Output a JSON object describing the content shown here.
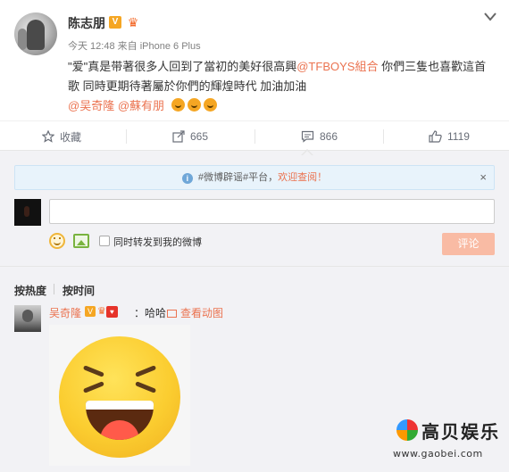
{
  "post": {
    "username": "陈志朋",
    "v_badge": "V",
    "time": "今天 12:48",
    "source_prefix": "来自",
    "source": "iPhone 6 Plus",
    "text_part1": "\"爱\"真是带著很多人回到了當初的美好很高興",
    "text_mention1": "@TFBOYS組合",
    "text_part2": " 你們三隻也喜歡這首歌 同時更期待著屬於你們的輝煌時代 加油加油",
    "mention2": "@吴奇隆",
    "mention3": "@蘇有朋"
  },
  "actions": {
    "favorite_label": "收藏",
    "repost_count": "665",
    "comment_count": "866",
    "like_count": "1119"
  },
  "notice": {
    "prefix": "#微博辟谣#平台，",
    "highlight": "欢迎查阅！",
    "close": "×",
    "info": "i"
  },
  "composer": {
    "input_placeholder": "",
    "forward_label": "同时转发到我的微博",
    "submit_label": "评论"
  },
  "sort": {
    "by_hot": "按热度",
    "by_time": "按时间"
  },
  "comment": {
    "name": "吴奇隆",
    "v_badge": "V",
    "text": "：哈哈",
    "view_anim": "查看动图"
  },
  "watermark": {
    "title": "高贝娱乐",
    "url": "www.gaobei.com"
  },
  "colors": {
    "accent": "#eb7350",
    "muted": "#808080",
    "submit_bg": "#f9bba4",
    "notice_bg": "#e8f3fb"
  }
}
